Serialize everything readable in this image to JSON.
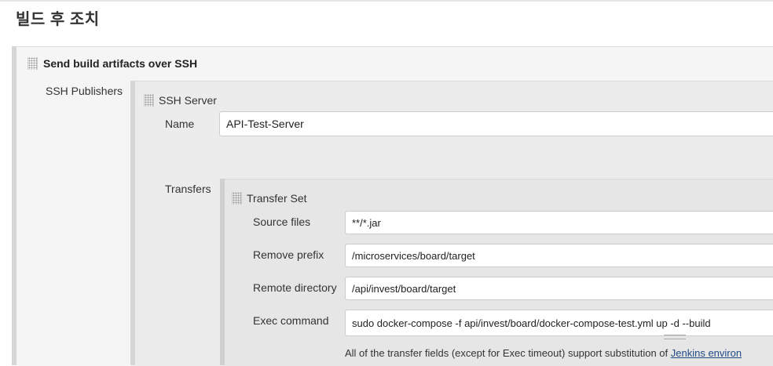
{
  "section": {
    "title": "빌드 후 조치"
  },
  "publisher": {
    "title": "Send build artifacts over SSH",
    "ssh_publishers_label": "SSH Publishers"
  },
  "server": {
    "title": "SSH Server",
    "name_label": "Name",
    "name_value": "API-Test-Server",
    "transfers_label": "Transfers"
  },
  "transfer_set": {
    "title": "Transfer Set",
    "source_files_label": "Source files",
    "source_files_value": "**/*.jar",
    "remove_prefix_label": "Remove prefix",
    "remove_prefix_value": "/microservices/board/target",
    "remote_directory_label": "Remote directory",
    "remote_directory_value": "/api/invest/board/target",
    "exec_command_label": "Exec command",
    "exec_command_value": "sudo docker-compose -f api/invest/board/docker-compose-test.yml up -d --build"
  },
  "help": {
    "text": "All of the transfer fields (except for Exec timeout) support substitution of ",
    "link_text": "Jenkins environ"
  }
}
